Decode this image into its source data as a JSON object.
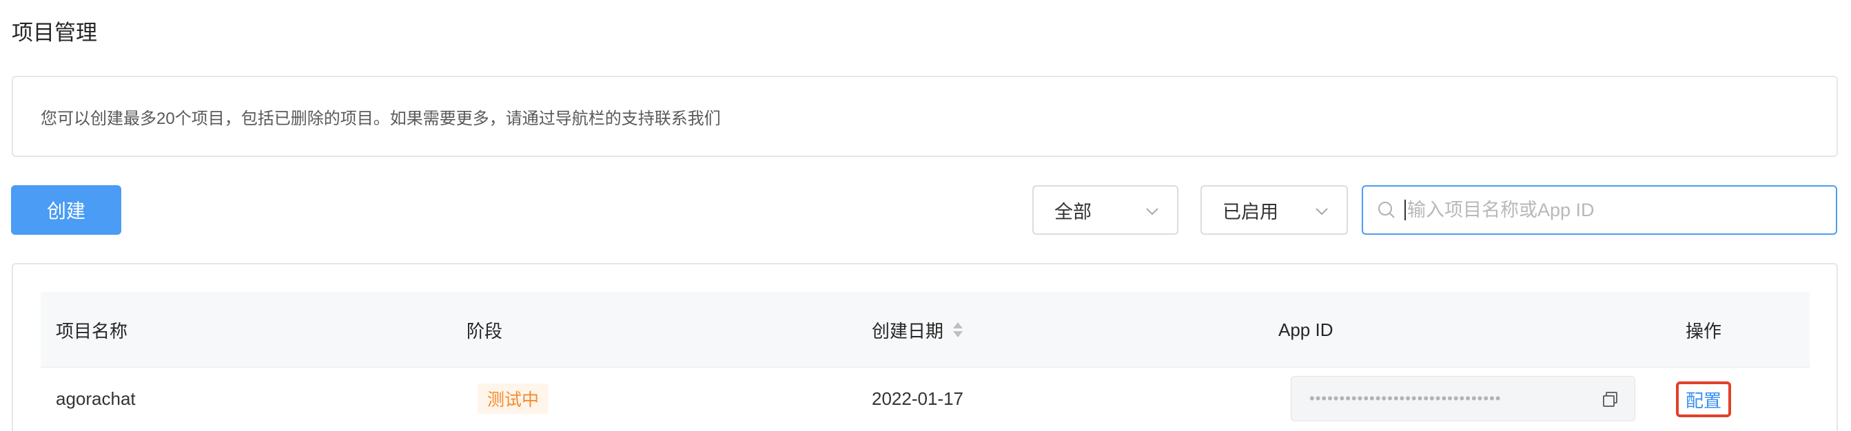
{
  "page": {
    "title": "项目管理"
  },
  "notice": {
    "text": "您可以创建最多20个项目，包括已删除的项目。如果需要更多，请通过导航栏的支持联系我们"
  },
  "toolbar": {
    "create_label": "创建",
    "filter_stage": {
      "selected": "全部"
    },
    "filter_status": {
      "selected": "已启用"
    },
    "search": {
      "placeholder": "输入项目名称或App ID",
      "value": ""
    }
  },
  "table": {
    "columns": {
      "name": "项目名称",
      "stage": "阶段",
      "created": "创建日期",
      "app_id": "App ID",
      "actions": "操作"
    },
    "rows": [
      {
        "name": "agorachat",
        "stage": "测试中",
        "created": "2022-01-17",
        "app_id_masked": "••••••••••••••••••••••••••••••••",
        "action_label": "配置"
      }
    ]
  },
  "colors": {
    "primary": "#4a9cf4",
    "link": "#3b8ff0",
    "badge_text": "#f58a2c",
    "badge_bg": "#fff5eb",
    "highlight": "#e2402b"
  },
  "icons": {
    "search": "search-icon",
    "chevron": "chevron-down-icon",
    "sort": "sort-icon",
    "copy": "copy-icon"
  }
}
